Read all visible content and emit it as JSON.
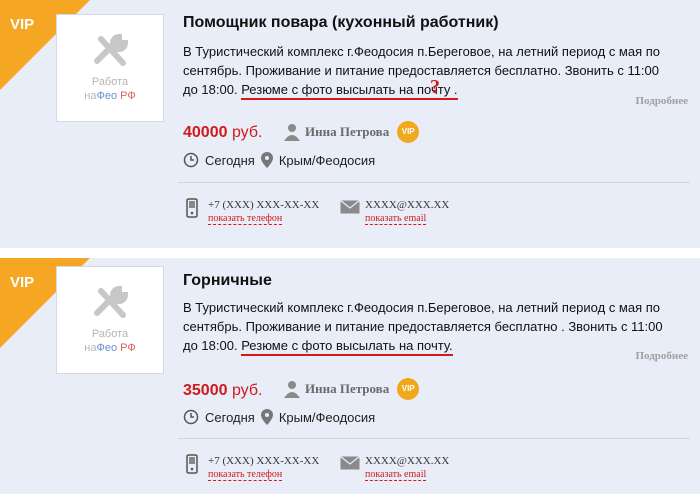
{
  "listings": [
    {
      "vip_label": "VIP",
      "thumb": {
        "prefix_top": "Работа",
        "prefix_na": "на",
        "brand_fe": "Фео",
        "brand_rf": "РФ"
      },
      "title": "Помощник повара (кухонный работник)",
      "desc_plain": "В Туристический комплекс г.Феодосия п.Береговое, на летний период с мая по сентябрь. Проживание и питание предоставляется бесплатно. Звонить с 11:00 до 18:00. ",
      "desc_highlight": "Резюме с фото высылать на почту .",
      "annotation": "?",
      "more_label": "Подробнее",
      "price": "40000",
      "currency": "руб.",
      "author": "Инна Петрова",
      "author_badge": "VIP",
      "date": "Сегодня",
      "location": "Крым/Феодосия",
      "phone": "+7 (XXX) XXX-XX-XX",
      "phone_link": "показать телефон",
      "email": "XXXX@XXX.XX",
      "email_link": "показать email"
    },
    {
      "vip_label": "VIP",
      "thumb": {
        "prefix_top": "Работа",
        "prefix_na": "на",
        "brand_fe": "Фео",
        "brand_rf": "РФ"
      },
      "title": "Горничные",
      "desc_plain": "В Туристический комплекс г.Феодосия п.Береговое, на летний период с мая по сентябрь. Проживание и питание предоставляется бесплатно . Звонить с 11:00 до 18:00. ",
      "desc_highlight": "Резюме с фото высылать на почту.",
      "annotation": "",
      "more_label": "Подробнее",
      "price": "35000",
      "currency": "руб.",
      "author": "Инна Петрова",
      "author_badge": "VIP",
      "date": "Сегодня",
      "location": "Крым/Феодосия",
      "phone": "+7 (XXX) XXX-XX-XX",
      "phone_link": "показать телефон",
      "email": "XXXX@XXX.XX",
      "email_link": "показать email"
    }
  ],
  "colors": {
    "accent": "#f5a623",
    "price": "#d11a1a",
    "card_bg": "#e9edf8"
  },
  "icons": [
    "tools-icon",
    "user-icon",
    "clock-icon",
    "location-pin-icon",
    "phone-icon",
    "envelope-icon"
  ]
}
